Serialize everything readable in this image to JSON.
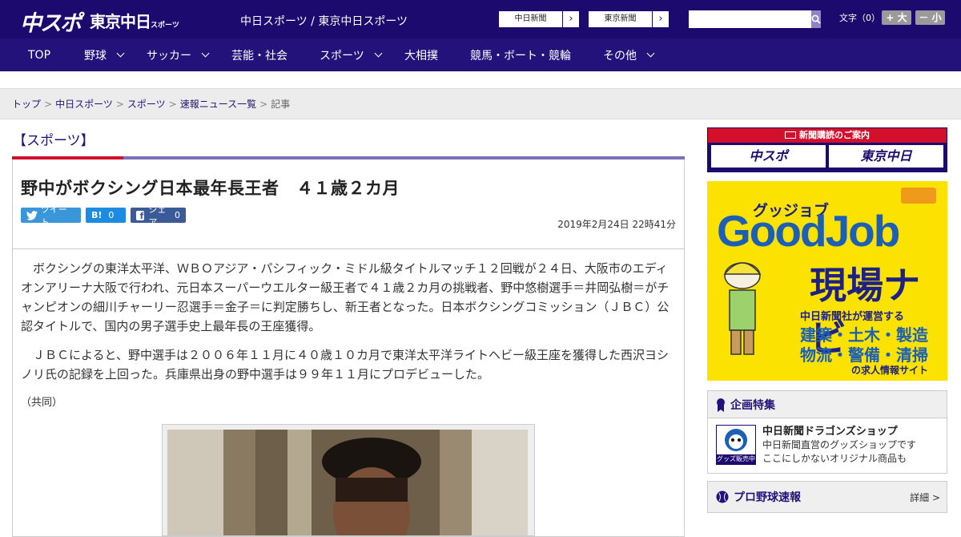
{
  "header": {
    "logo_chuspo": "中スポ",
    "logo_tokyo": "東京中日",
    "logo_tokyo_small": "スポーツ",
    "site_title": "中日スポーツ / 東京中日スポーツ",
    "links": [
      {
        "label": "中日新聞",
        "arrow": "›"
      },
      {
        "label": "東京新聞",
        "arrow": "›"
      }
    ],
    "search": {
      "value": "",
      "placeholder": ""
    },
    "font_size_label": "文字（0）",
    "font_larger": "+ 大",
    "font_smaller": "－ 小"
  },
  "nav": {
    "items": [
      {
        "label": "TOP",
        "has_menu": false
      },
      {
        "label": "野球",
        "has_menu": true
      },
      {
        "label": "サッカー",
        "has_menu": true
      },
      {
        "label": "芸能・社会",
        "has_menu": false
      },
      {
        "label": "スポーツ",
        "has_menu": true
      },
      {
        "label": "大相撲",
        "has_menu": false
      },
      {
        "label": "競馬・ボート・競輪",
        "has_menu": false
      },
      {
        "label": "その他",
        "has_menu": true
      }
    ]
  },
  "breadcrumb": {
    "items": [
      "トップ",
      "中日スポーツ",
      "スポーツ",
      "速報ニュース一覧"
    ],
    "current": "記事",
    "separator": ">"
  },
  "article": {
    "category": "【スポーツ】",
    "title": "野中がボクシング日本最年長王者　４１歳２カ月",
    "share": {
      "tweet": "ツイート",
      "hatena_icon": "B!",
      "hatena_count": "0",
      "facebook": "シェア",
      "facebook_count": "0"
    },
    "date": "2019年2月24日 22時41分",
    "paragraphs": [
      "ボクシングの東洋太平洋、ＷＢＯアジア・パシフィック・ミドル級タイトルマッチ１２回戦が２４日、大阪市のエディオンアリーナ大阪で行われ、元日本スーパーウエルター級王者で４１歳２カ月の挑戦者、野中悠樹選手＝井岡弘樹＝がチャンピオンの細川チャーリー忍選手＝金子＝に判定勝ちし、新王者となった。日本ボクシングコミッション（ＪＢＣ）公認タイトルで、国内の男子選手史上最年長の王座獲得。",
      "ＪＢＣによると、野中選手は２００６年１１月に４０歳１０カ月で東洋太平洋ライトヘビー級王座を獲得した西沢ヨシノリ氏の記録を上回った。兵庫県出身の野中選手は９９年１１月にプロデビューした。"
    ],
    "source": "（共同）"
  },
  "sidebar": {
    "subscribe_banner": {
      "title": "新聞購読のご案内",
      "left": "中スポ",
      "right": "東京中日"
    },
    "goodjob_ad": {
      "kana": "グッジョブ",
      "english": "GoodJob",
      "headline": "現場ナビ",
      "company": "中日新聞社が運営する",
      "jobs_line1": "建築・土木・製造",
      "jobs_line2": "物流・警備・清掃",
      "site": "の求人情報サイト"
    },
    "feature_panel": {
      "title": "企画特集",
      "shop_title": "中日新聞ドラゴンズショップ",
      "shop_line1": "中日新聞直営のグッズショップです",
      "shop_line2": "ここにしかないオリジナル商品も",
      "icon_badge": "グッズ販売中"
    },
    "baseball_panel": {
      "title": "プロ野球速報",
      "more": "詳細 >"
    }
  },
  "colors": {
    "header_bg": "#1c0a6e",
    "nav_bg": "#23127a",
    "accent_red": "#d2102c",
    "ad_yellow": "#fce200"
  }
}
